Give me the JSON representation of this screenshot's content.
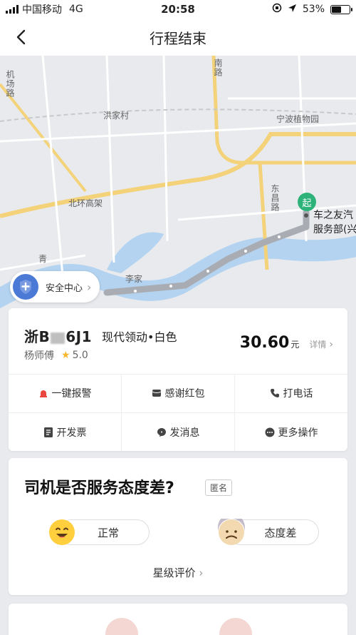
{
  "status_bar": {
    "carrier": "中国移动",
    "network": "4G",
    "time": "20:58",
    "battery": "53%",
    "battery_level": 0.53
  },
  "nav": {
    "title": "行程结束",
    "back_icon": "chevron-left-icon"
  },
  "map": {
    "labels": {
      "road_nan": "南",
      "road_lu": "路",
      "village": "洪家村",
      "garden": "宁波植物园",
      "highway": "北环高架",
      "dongchang_road": "东昌路",
      "airport_road": "机场路",
      "qing": "青",
      "lijia": "李家"
    },
    "destination_line1": "车之友汽",
    "destination_line2": "服务部(兴",
    "start_pin": "起",
    "route_color": "#a9adb3",
    "water_color": "#aed0ef"
  },
  "safety": {
    "label": "安全中心",
    "icon": "shield-plus-icon"
  },
  "driver_card": {
    "plate_prefix": "浙B",
    "plate_suffix": "6J1",
    "car": "现代领动•白色",
    "driver_name": "杨师傅",
    "rating": "5.0",
    "price": "30.60",
    "unit": "元",
    "detail": "详情",
    "actions": [
      {
        "label": "一键报警",
        "icon": "alarm-light-icon",
        "color": "#e8463e"
      },
      {
        "label": "感谢红包",
        "icon": "red-packet-icon",
        "color": "#444444"
      },
      {
        "label": "打电话",
        "icon": "phone-icon",
        "color": "#444444"
      },
      {
        "label": "开发票",
        "icon": "invoice-icon",
        "color": "#444444"
      },
      {
        "label": "发消息",
        "icon": "message-icon",
        "color": "#444444"
      },
      {
        "label": "更多操作",
        "icon": "more-icon",
        "color": "#444444"
      }
    ]
  },
  "survey": {
    "title": "司机是否服务态度差?",
    "anonymous": "匿名",
    "option_normal": "正常",
    "option_bad": "态度差",
    "star_rating": "星级评价"
  }
}
